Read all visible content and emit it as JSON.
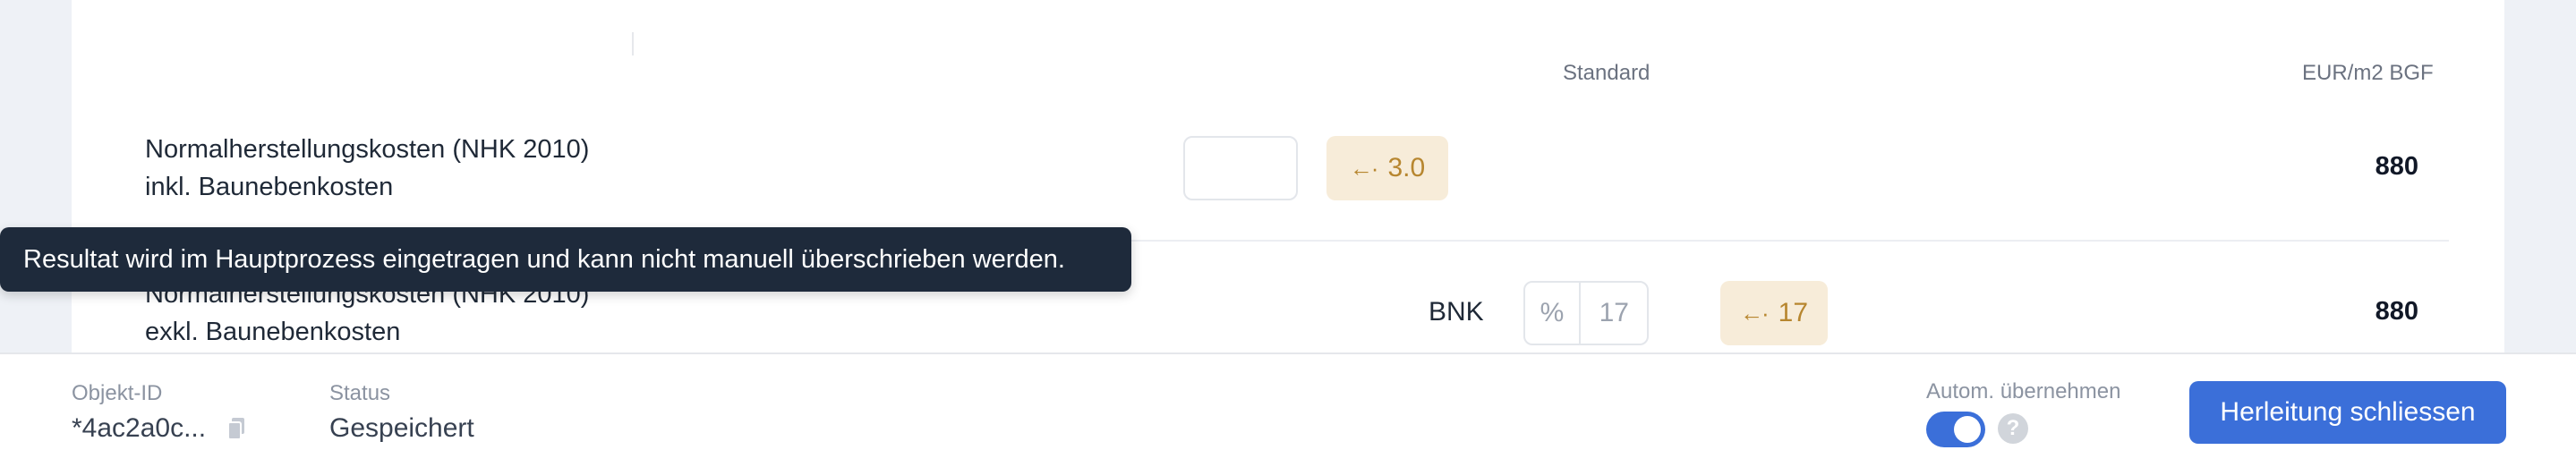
{
  "table": {
    "headers": {
      "standard": "Standard",
      "unit": "EUR/m2 BGF"
    },
    "rows": [
      {
        "label_line1": "Normalherstellungskosten (NHK 2010)",
        "label_line2": "inkl. Baunebenkosten",
        "input_value": "",
        "suggestion": "3.0",
        "result": "880"
      },
      {
        "label_line1": "Normalherstellungskosten (NHK 2010)",
        "label_line2": "exkl. Baunebenkosten",
        "prefix_label": "BNK",
        "input_unit": "%",
        "input_placeholder": "17",
        "suggestion": "17",
        "result": "880"
      }
    ]
  },
  "tooltip": {
    "text": "Resultat wird im Hauptprozess eingetragen und kann nicht manuell überschrieben werden."
  },
  "footer": {
    "object_id_label": "Objekt-ID",
    "object_id_value": "*4ac2a0c...",
    "status_label": "Status",
    "status_value": "Gespeichert",
    "auto_apply_label": "Autom. übernehmen",
    "auto_apply_enabled": true,
    "help_glyph": "?",
    "close_button_label": "Herleitung schliessen"
  },
  "icons": {
    "suggestion_arrow": "arrow-left-dotted-icon",
    "copy": "copy-icon",
    "help": "question-circle-icon"
  },
  "colors": {
    "accent": "#3b6fd9",
    "suggestion_bg": "#f7ecd9",
    "suggestion_text": "#b7862f",
    "tooltip_bg": "#1e2a3b",
    "page_bg": "#eef1f6"
  }
}
